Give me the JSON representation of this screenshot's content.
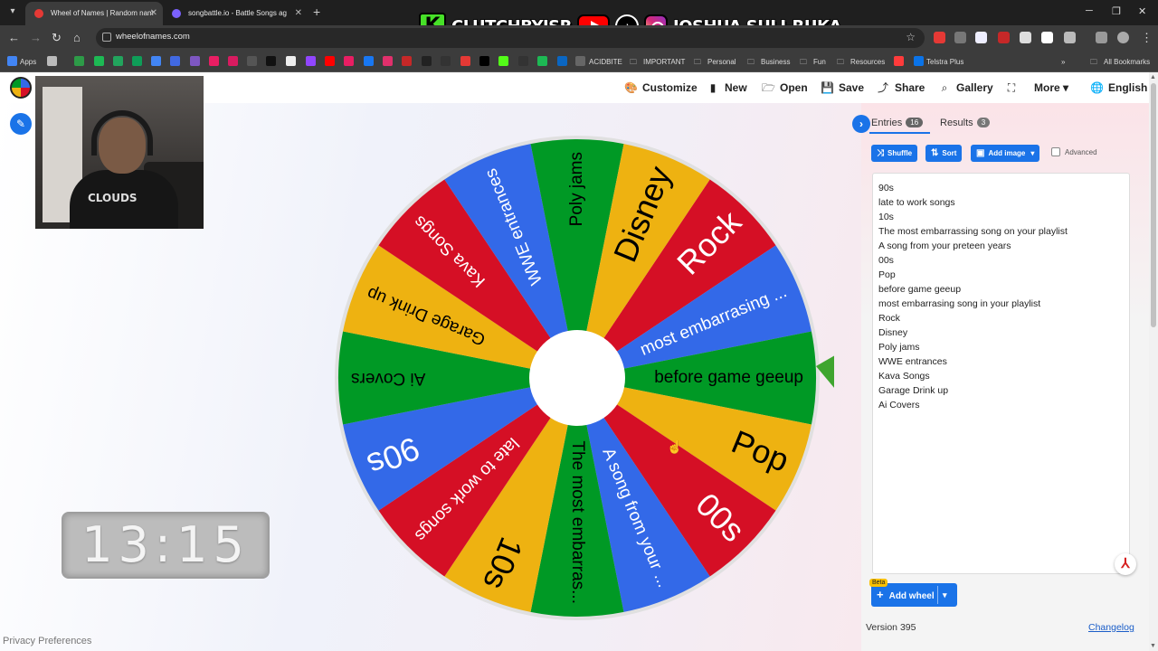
{
  "browser": {
    "tabs": [
      {
        "title": "Wheel of Names | Random nam",
        "active": true,
        "favicon_color": "#e53935"
      },
      {
        "title": "songbattle.io - Battle Songs ag",
        "active": false,
        "favicon_color": "#7b61ff"
      }
    ],
    "url": "wheelofnames.com",
    "bookmarks": {
      "apps_label": "Apps",
      "items": [
        "ACIDBITE",
        "IMPORTANT",
        "Personal",
        "Business",
        "Fun",
        "Resources",
        "Telstra Plus"
      ],
      "all_label": "All Bookmarks"
    },
    "banner": {
      "brand_text": "CLUTCHBYJSR",
      "name_text": "JOSHUA SULI-RUKA"
    }
  },
  "header": {
    "customize": "Customize",
    "new": "New",
    "open": "Open",
    "save": "Save",
    "share": "Share",
    "gallery": "Gallery",
    "more": "More",
    "language": "English"
  },
  "webcam": {
    "shirt_text": "CLOUDS"
  },
  "timer": {
    "value": "13:15"
  },
  "privacy_link": "Privacy Preferences",
  "panel": {
    "tabs": [
      {
        "label": "Entries",
        "count": "16"
      },
      {
        "label": "Results",
        "count": "3"
      }
    ],
    "buttons": {
      "shuffle": "Shuffle",
      "sort": "Sort",
      "add_image": "Add image"
    },
    "advanced_label": "Advanced",
    "entries": [
      "90s",
      "late to work songs",
      "10s",
      "The most embarrassing song on your playlist",
      "A song from your preteen years",
      "00s",
      "Pop",
      "before game geeup",
      "most embarrasing song in your playlist",
      "Rock",
      "Disney",
      "Poly jams",
      "WWE entrances",
      "Kava Songs",
      "Garage Drink up",
      "Ai Covers"
    ],
    "beta_label": "Beta",
    "add_wheel": "Add wheel",
    "version": "Version 395",
    "changelog": "Changelog"
  },
  "wheel": {
    "colors": {
      "green": "#009925",
      "blue": "#3369e8",
      "red": "#d50f25",
      "yellow": "#eeb211",
      "pointer": "#3fa52f"
    },
    "segments": [
      {
        "label": "Rock",
        "color": "red"
      },
      {
        "label": "most embarrasing ...",
        "color": "blue"
      },
      {
        "label": "before game geeup",
        "color": "green"
      },
      {
        "label": "Pop",
        "color": "yellow"
      },
      {
        "label": "00s",
        "color": "red"
      },
      {
        "label": "A song from your ...",
        "color": "blue"
      },
      {
        "label": "The most embarras...",
        "color": "green"
      },
      {
        "label": "10s",
        "color": "yellow"
      },
      {
        "label": "late to work songs",
        "color": "red"
      },
      {
        "label": "90s",
        "color": "blue"
      },
      {
        "label": "Ai Covers",
        "color": "green"
      },
      {
        "label": "Garage Drink up",
        "color": "yellow"
      },
      {
        "label": "Kava Songs",
        "color": "red"
      },
      {
        "label": "WWE entrances",
        "color": "blue"
      },
      {
        "label": "Poly jams",
        "color": "green"
      },
      {
        "label": "Disney",
        "color": "yellow"
      }
    ]
  }
}
